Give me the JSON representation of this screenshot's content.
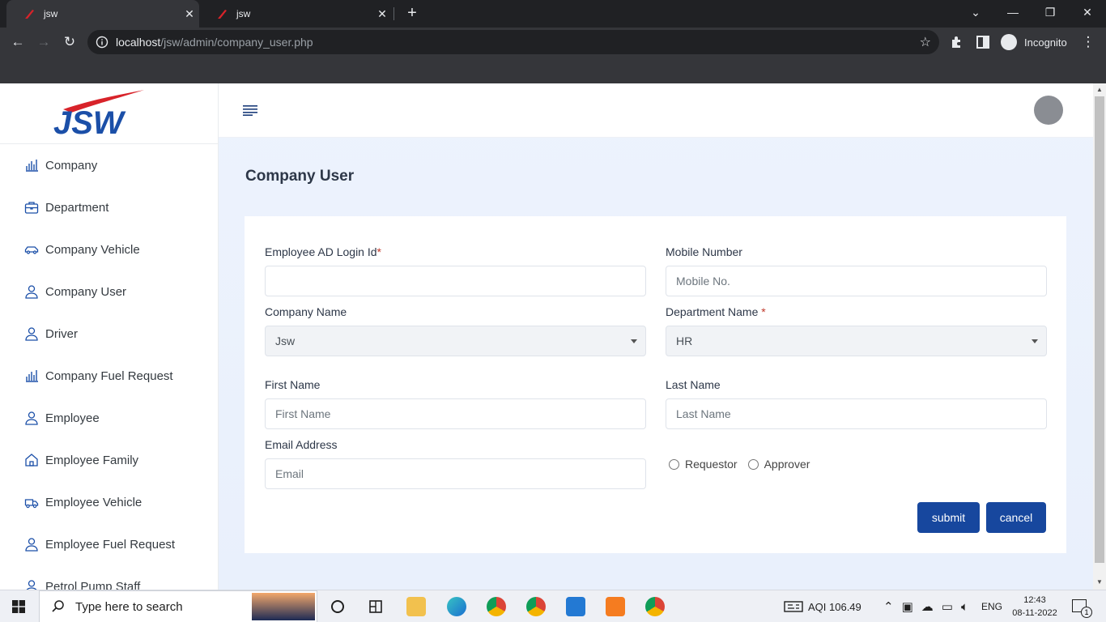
{
  "browser": {
    "tabs": [
      {
        "title": "jsw",
        "active": true
      },
      {
        "title": "jsw",
        "active": false
      }
    ],
    "url_host": "localhost",
    "url_path": "/jsw/admin/company_user.php",
    "profile_label": "Incognito"
  },
  "sidebar": {
    "logo_text": "JSW",
    "items": [
      {
        "label": "Company",
        "icon": "bar-chart-icon"
      },
      {
        "label": "Department",
        "icon": "briefcase-icon"
      },
      {
        "label": "Company Vehicle",
        "icon": "car-icon"
      },
      {
        "label": "Company User",
        "icon": "user-icon"
      },
      {
        "label": "Driver",
        "icon": "user-icon"
      },
      {
        "label": "Company Fuel Request",
        "icon": "bar-chart-icon"
      },
      {
        "label": "Employee",
        "icon": "user-icon"
      },
      {
        "label": "Employee Family",
        "icon": "home-icon"
      },
      {
        "label": "Employee Vehicle",
        "icon": "truck-icon"
      },
      {
        "label": "Employee Fuel Request",
        "icon": "user-icon"
      },
      {
        "label": "Petrol Pump Staff",
        "icon": "user-icon"
      }
    ]
  },
  "main": {
    "page_title": "Company User",
    "form": {
      "employee_ad_login": {
        "label": "Employee AD Login Id",
        "required_mark": "*",
        "value": "",
        "placeholder": ""
      },
      "mobile": {
        "label": "Mobile Number",
        "placeholder": "Mobile No."
      },
      "company_name": {
        "label": "Company Name",
        "selected": "Jsw"
      },
      "department_name": {
        "label": "Department Name ",
        "required_mark": "*",
        "selected": "HR"
      },
      "first_name": {
        "label": "First Name",
        "placeholder": "First Name"
      },
      "last_name": {
        "label": "Last Name",
        "placeholder": "Last Name"
      },
      "email": {
        "label": "Email Address",
        "placeholder": "Email"
      },
      "role_options": [
        "Requestor",
        "Approver"
      ],
      "submit_label": "submit",
      "cancel_label": "cancel"
    }
  },
  "taskbar": {
    "search_placeholder": "Type here to search",
    "aqi": "AQI 106.49",
    "lang": "ENG",
    "time": "12:43",
    "date": "08-11-2022",
    "notification_count": "1"
  },
  "colors": {
    "primary": "#17479e",
    "logo_blue": "#1b4fa8",
    "logo_red": "#d8232a"
  }
}
